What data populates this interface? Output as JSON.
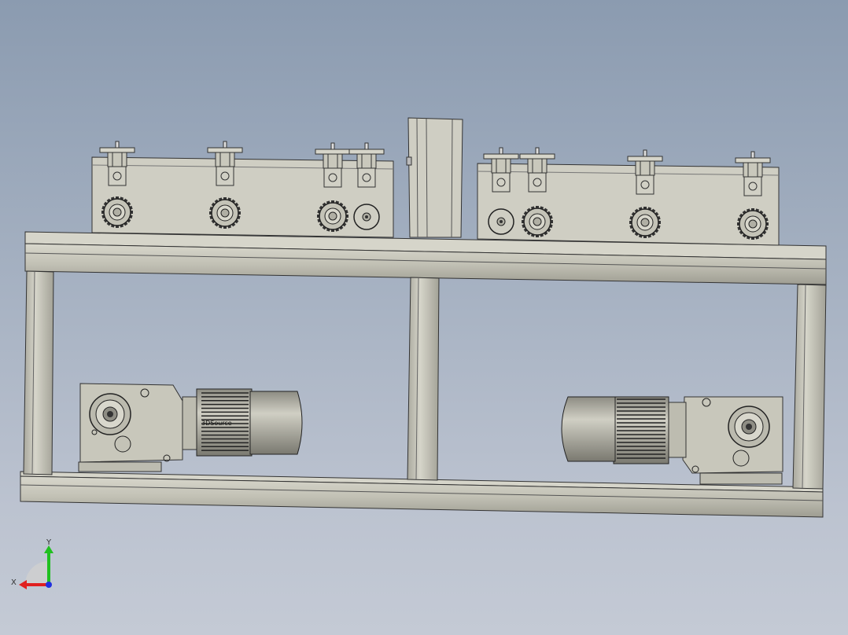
{
  "viewport": {
    "background_top": "#8b9bb0",
    "background_bottom": "#c4cad5"
  },
  "model": {
    "name": "roller-feeder-machine-assembly",
    "motor_label": "3DSource",
    "part_color": "#c9c8bb",
    "edge_color": "#2a2a2a",
    "motor_color": "#b9b8ad"
  },
  "triad": {
    "x_label": "X",
    "y_label": "Y",
    "x_color": "#e02020",
    "y_color": "#20c020",
    "z_color": "#2030e0"
  }
}
